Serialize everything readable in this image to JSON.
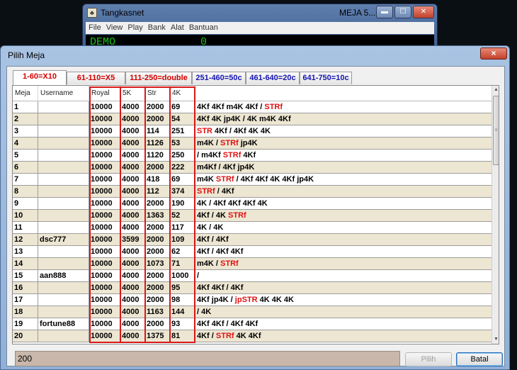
{
  "bg_window": {
    "title": "Tangkasnet",
    "title_right": "MEJA 5...",
    "menu": [
      "File",
      "View",
      "Play",
      "Bank",
      "Alat",
      "Bantuan"
    ],
    "demo_label": "DEMO",
    "demo_value": "0"
  },
  "dialog": {
    "title": "Pilih Meja",
    "close_label": "×",
    "tabs": [
      {
        "label": "1-60=X10",
        "color": "red",
        "active": true
      },
      {
        "label": "61-110=X5",
        "color": "red",
        "active": false
      },
      {
        "label": "111-250=double",
        "color": "red",
        "active": false
      },
      {
        "label": "251-460=50c",
        "color": "blue",
        "active": false
      },
      {
        "label": "461-640=20c",
        "color": "blue",
        "active": false
      },
      {
        "label": "641-750=10c",
        "color": "blue",
        "active": false
      }
    ],
    "columns": [
      "Meja",
      "Username",
      "Royal",
      "5K",
      "Str",
      "4K",
      ""
    ],
    "rows": [
      {
        "meja": "1",
        "user": "",
        "royal": "10000",
        "k5": "4000",
        "str": "2000",
        "k4": "69",
        "hand": [
          [
            "4Kf 4Kf m4K 4Kf / ",
            ""
          ],
          [
            "STRf",
            "r"
          ]
        ]
      },
      {
        "meja": "2",
        "user": "",
        "royal": "10000",
        "k5": "4000",
        "str": "2000",
        "k4": "54",
        "hand": [
          [
            "4Kf 4K jp4K / 4K m4K 4Kf",
            ""
          ]
        ]
      },
      {
        "meja": "3",
        "user": "",
        "royal": "10000",
        "k5": "4000",
        "str": "114",
        "k4": "251",
        "hand": [
          [
            "STR",
            "r"
          ],
          [
            " 4Kf / 4Kf 4K 4K",
            ""
          ]
        ]
      },
      {
        "meja": "4",
        "user": "",
        "royal": "10000",
        "k5": "4000",
        "str": "1126",
        "k4": "53",
        "hand": [
          [
            "m4K / ",
            ""
          ],
          [
            "STRf",
            "r"
          ],
          [
            " jp4K",
            ""
          ]
        ]
      },
      {
        "meja": "5",
        "user": "",
        "royal": "10000",
        "k5": "4000",
        "str": "1120",
        "k4": "250",
        "hand": [
          [
            "/ m4Kf ",
            ""
          ],
          [
            "STRf",
            "r"
          ],
          [
            " 4Kf",
            ""
          ]
        ]
      },
      {
        "meja": "6",
        "user": "",
        "royal": "10000",
        "k5": "4000",
        "str": "2000",
        "k4": "222",
        "hand": [
          [
            "m4Kf / 4Kf jp4K",
            ""
          ]
        ]
      },
      {
        "meja": "7",
        "user": "",
        "royal": "10000",
        "k5": "4000",
        "str": "418",
        "k4": "69",
        "hand": [
          [
            "m4K ",
            ""
          ],
          [
            "STRf",
            "r"
          ],
          [
            " / 4Kf 4Kf 4K 4Kf jp4K",
            ""
          ]
        ]
      },
      {
        "meja": "8",
        "user": "",
        "royal": "10000",
        "k5": "4000",
        "str": "112",
        "k4": "374",
        "hand": [
          [
            "STRf",
            "r"
          ],
          [
            " / 4Kf",
            ""
          ]
        ]
      },
      {
        "meja": "9",
        "user": "",
        "royal": "10000",
        "k5": "4000",
        "str": "2000",
        "k4": "190",
        "hand": [
          [
            "4K / 4Kf 4Kf 4Kf 4K",
            ""
          ]
        ]
      },
      {
        "meja": "10",
        "user": "",
        "royal": "10000",
        "k5": "4000",
        "str": "1363",
        "k4": "52",
        "hand": [
          [
            "4Kf / 4K ",
            ""
          ],
          [
            "STRf",
            "r"
          ]
        ]
      },
      {
        "meja": "11",
        "user": "",
        "royal": "10000",
        "k5": "4000",
        "str": "2000",
        "k4": "117",
        "hand": [
          [
            "4K / 4K",
            ""
          ]
        ]
      },
      {
        "meja": "12",
        "user": "dsc777",
        "royal": "10000",
        "k5": "3599",
        "str": "2000",
        "k4": "109",
        "hand": [
          [
            "4Kf / 4Kf",
            ""
          ]
        ]
      },
      {
        "meja": "13",
        "user": "",
        "royal": "10000",
        "k5": "4000",
        "str": "2000",
        "k4": "62",
        "hand": [
          [
            "4Kf / 4Kf 4Kf",
            ""
          ]
        ]
      },
      {
        "meja": "14",
        "user": "",
        "royal": "10000",
        "k5": "4000",
        "str": "1073",
        "k4": "71",
        "hand": [
          [
            "m4K / ",
            ""
          ],
          [
            "STRf",
            "r"
          ]
        ]
      },
      {
        "meja": "15",
        "user": "aan888",
        "royal": "10000",
        "k5": "4000",
        "str": "2000",
        "k4": "1000",
        "hand": [
          [
            "/",
            ""
          ]
        ]
      },
      {
        "meja": "16",
        "user": "",
        "royal": "10000",
        "k5": "4000",
        "str": "2000",
        "k4": "95",
        "hand": [
          [
            "4Kf 4Kf / 4Kf",
            ""
          ]
        ]
      },
      {
        "meja": "17",
        "user": "",
        "royal": "10000",
        "k5": "4000",
        "str": "2000",
        "k4": "98",
        "hand": [
          [
            "4Kf jp4K / ",
            ""
          ],
          [
            "jpSTR",
            "r"
          ],
          [
            " 4K 4K 4K",
            ""
          ]
        ]
      },
      {
        "meja": "18",
        "user": "",
        "royal": "10000",
        "k5": "4000",
        "str": "1163",
        "k4": "144",
        "hand": [
          [
            "/ 4K",
            ""
          ]
        ]
      },
      {
        "meja": "19",
        "user": "fortune88",
        "royal": "10000",
        "k5": "4000",
        "str": "2000",
        "k4": "93",
        "hand": [
          [
            "4Kf 4Kf / 4Kf 4Kf",
            ""
          ]
        ]
      },
      {
        "meja": "20",
        "user": "",
        "royal": "10000",
        "k5": "4000",
        "str": "1375",
        "k4": "81",
        "hand": [
          [
            "4Kf / ",
            ""
          ],
          [
            "STRf",
            "r"
          ],
          [
            " 4K 4Kf",
            ""
          ]
        ]
      }
    ],
    "bottom_value": "200",
    "buttons": {
      "pilih": "Pilih",
      "batal": "Batal"
    }
  },
  "colors": {
    "highlight_red": "#e01010",
    "tab_red": "#d40000",
    "tab_blue": "#1515b0",
    "row_alt": "#ece6d2"
  }
}
